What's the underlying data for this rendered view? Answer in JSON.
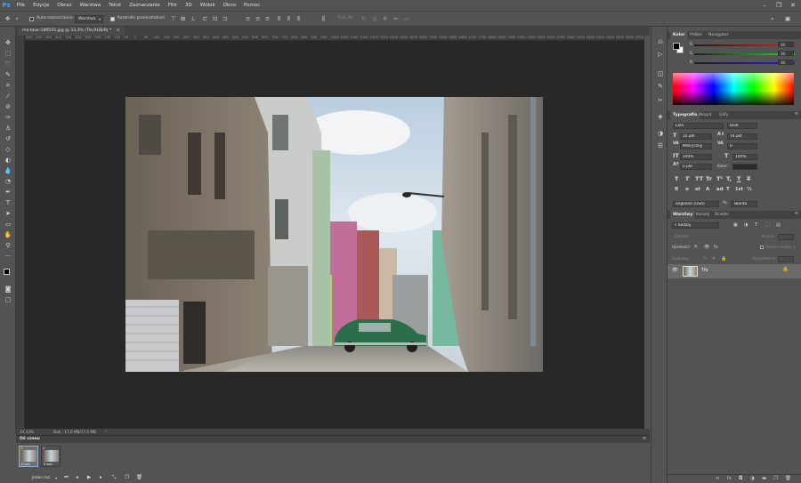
{
  "menu": [
    "Plik",
    "Edycja",
    "Obraz",
    "Warstwa",
    "Tekst",
    "Zaznaczanie",
    "Filtr",
    "3D",
    "Widok",
    "Okno",
    "Pomoc"
  ],
  "options": {
    "auto_select_label": "Auto-zaznaczanie:",
    "auto_select_value": "Warstwa",
    "transform_label": "Kontrolki przekształceń",
    "mode_3d": "Tryb 3D:"
  },
  "document": {
    "tab_title": "ma-blue-189555.jpg @ 33,3% (Tło,RGB/8) *",
    "zoom": "33,33%",
    "doc_info": "Dok.: 17,0 MB/17,0 MB",
    "ruler_ticks": [
      "550",
      "500",
      "450",
      "400",
      "350",
      "300",
      "250",
      "200",
      "150",
      "100",
      "50",
      "0",
      "50",
      "100",
      "150",
      "200",
      "250",
      "300",
      "350",
      "400",
      "450",
      "500",
      "550",
      "600",
      "650",
      "700",
      "750",
      "800",
      "850",
      "900",
      "950",
      "1000",
      "1050",
      "1100",
      "1150",
      "1200",
      "1250",
      "1300",
      "1350",
      "1400",
      "1450",
      "1500",
      "1550",
      "1600",
      "1650",
      "1700",
      "1750",
      "1800",
      "1850",
      "1900",
      "1950",
      "2000",
      "2050",
      "2100",
      "2150",
      "2200",
      "2250",
      "2300",
      "2350",
      "2400",
      "2450",
      "2500",
      "2550"
    ]
  },
  "timeline": {
    "title": "Oś czasu",
    "frames": [
      {
        "num": "1",
        "delay": "0 sek."
      },
      {
        "num": "2",
        "delay": "0 sek."
      }
    ],
    "loop": "Jeden raz"
  },
  "color_panel": {
    "tabs": [
      "Kolor",
      "Próbki",
      "Navigator"
    ],
    "channels": [
      {
        "label": "R",
        "value": "30"
      },
      {
        "label": "G",
        "value": "30"
      },
      {
        "label": "B",
        "value": "30"
      }
    ]
  },
  "typography_panel": {
    "tabs": [
      "Typografia",
      "Akapit",
      "Glify"
    ],
    "font_family": "Lato",
    "font_style": "Bold",
    "font_size": "10 pkt",
    "leading": "14 pkt",
    "kerning": "Metryczny",
    "tracking": "0",
    "vscale": "100%",
    "hscale": "100%",
    "baseline": "0 pkt",
    "color_label": "Kolor:",
    "language": "angielski (USA)",
    "antialias": "Twarda",
    "style_glyphs": [
      "T",
      "T",
      "TT",
      "Tr",
      "T¹",
      "T,",
      "T",
      "T"
    ],
    "ot_glyphs": [
      "fi",
      "ơ",
      "st",
      "A",
      "ad",
      "T",
      "1st",
      "½"
    ],
    "aa_label": "ªa"
  },
  "layers_panel": {
    "tabs": [
      "Warstwy",
      "Kanały",
      "Ścieżki"
    ],
    "filter_kind": "Rodzaj",
    "blend_mode": "Zwykłe",
    "opacity_label": "Krycie:",
    "unify_label": "Ujednolić:",
    "propagate_label": "Rozwiń klatkę 1",
    "lock_label": "Zablokuj:",
    "fill_label": "Wypełnienie:",
    "layer_name": "Tło"
  },
  "colors": {
    "accent": "#31a8ff",
    "bg": "#535353",
    "canvas": "#282828"
  }
}
